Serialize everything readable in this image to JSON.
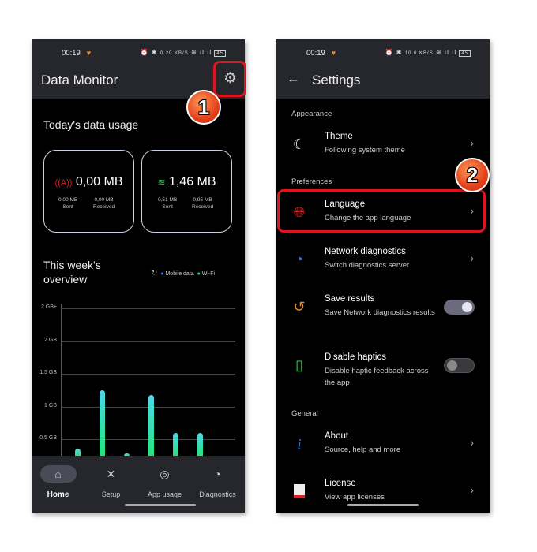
{
  "left": {
    "status": {
      "time": "00:19",
      "net_speed": "0.20 KB/S",
      "battery": "45"
    },
    "title": "Data Monitor",
    "today_title": "Today's data usage",
    "mobile": {
      "total": "0,00 MB",
      "sent": "0,00 MB",
      "sent_label": "Sent",
      "received": "0,00 MB",
      "received_label": "Received"
    },
    "wifi": {
      "total": "1,46 MB",
      "sent": "0,51 MB",
      "sent_label": "Sent",
      "received": "0,95 MB",
      "received_label": "Received"
    },
    "week_title": "This week's overview",
    "legend": {
      "mobile": "Mobile data",
      "wifi": "Wi-Fi",
      "mobile_color": "#2f7ff0",
      "wifi_color": "#2de38a"
    },
    "chart_data": {
      "type": "bar",
      "yticks": [
        "2 GB+",
        "2 GB",
        "1.5 GB",
        "1 GB",
        "0.5 GB"
      ],
      "ytick_values": [
        2.5,
        2,
        1.5,
        1,
        0.5
      ],
      "unit": "GB",
      "values": [
        0.35,
        1.25,
        0.28,
        1.17,
        0.6,
        0.6
      ]
    },
    "nav": [
      {
        "label": "Home",
        "icon": "home-icon"
      },
      {
        "label": "Setup",
        "icon": "tools-icon"
      },
      {
        "label": "App usage",
        "icon": "android-icon"
      },
      {
        "label": "Diagnostics",
        "icon": "gauge-icon"
      }
    ]
  },
  "right": {
    "status": {
      "time": "00:19",
      "net_speed": "10.0 KB/S",
      "battery": "45"
    },
    "title": "Settings",
    "sections": {
      "appearance": "Appearance",
      "preferences": "Preferences",
      "general": "General"
    },
    "items": {
      "theme": {
        "title": "Theme",
        "subtitle": "Following system theme"
      },
      "language": {
        "title": "Language",
        "subtitle": "Change the app language"
      },
      "network": {
        "title": "Network diagnostics",
        "subtitle": "Switch diagnostics server"
      },
      "save": {
        "title": "Save results",
        "subtitle": "Save Network diagnostics results",
        "on": true
      },
      "haptics": {
        "title": "Disable haptics",
        "subtitle": "Disable haptic feedback across the app",
        "on": false
      },
      "about": {
        "title": "About",
        "subtitle": "Source, help and more"
      },
      "license": {
        "title": "License",
        "subtitle": "View app licenses"
      }
    }
  },
  "badges": {
    "one": "1",
    "two": "2"
  }
}
